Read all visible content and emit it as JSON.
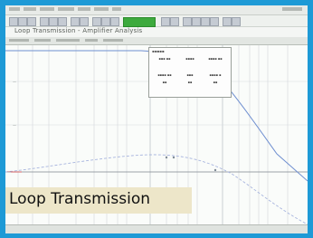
{
  "banner": {
    "text": "Loop Transmission"
  },
  "window": {
    "title": "Loop Transmission - Amplifier Analysis"
  },
  "colors": {
    "frame": "#1e9ad6",
    "curve": "#6f8fd0",
    "phase": "#a7b4de",
    "grid": "#c9cdd3",
    "marker": "#e05050",
    "toolbar_accent": "#3daa3d"
  }
}
